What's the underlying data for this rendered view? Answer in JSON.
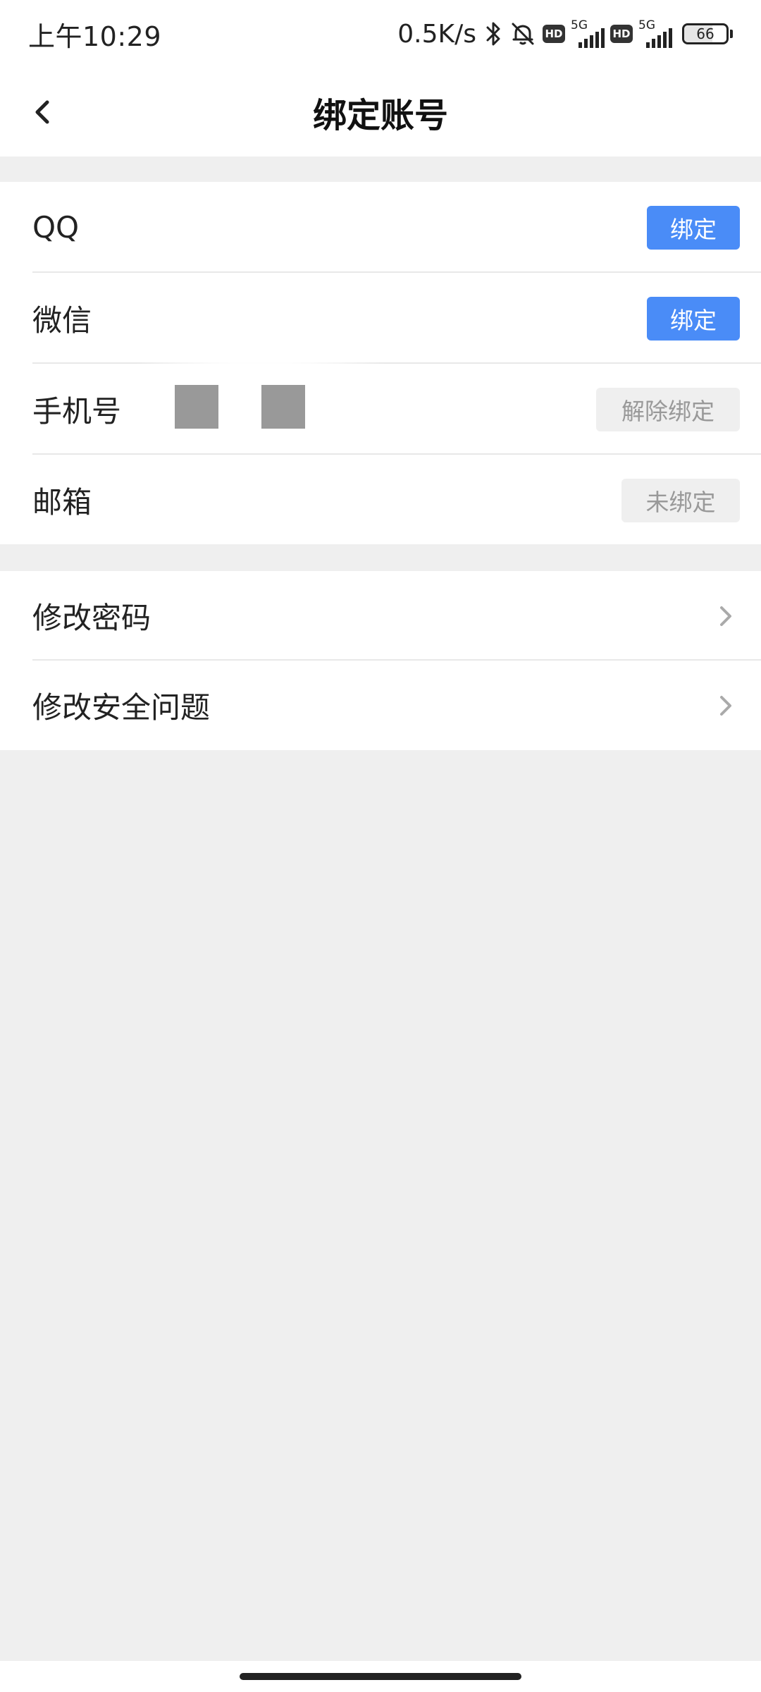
{
  "status_bar": {
    "time": "上午10:29",
    "net_speed": "0.5K/s",
    "hd_label": "HD",
    "network_label": "5G",
    "battery_level": "66",
    "battery_fraction": 0.66,
    "icons": [
      "bluetooth-icon",
      "bell-muted-icon",
      "hd-icon",
      "signal-icon",
      "battery-icon"
    ]
  },
  "header": {
    "title": "绑定账号"
  },
  "bindings": [
    {
      "label": "QQ",
      "action": "绑定",
      "state": "unbound-action"
    },
    {
      "label": "微信",
      "action": "绑定",
      "state": "unbound-action"
    },
    {
      "label": "手机号",
      "action": "解除绑定",
      "state": "bound"
    },
    {
      "label": "邮箱",
      "action": "未绑定",
      "state": "disabled"
    }
  ],
  "settings": [
    {
      "label": "修改密码"
    },
    {
      "label": "修改安全问题"
    }
  ],
  "colors": {
    "primary": "#4a8cf7",
    "disabled_bg": "#efefef",
    "disabled_text": "#999999",
    "page_bg": "#efefef"
  }
}
